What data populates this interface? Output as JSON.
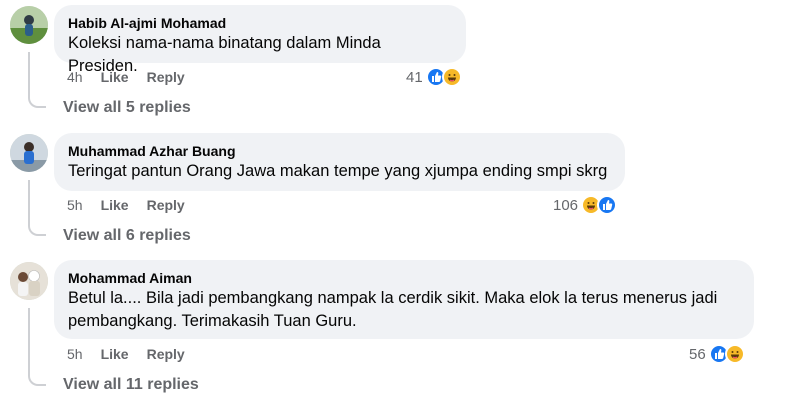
{
  "comments": [
    {
      "author": "Habib Al-ajmi Mohamad",
      "text": "Koleksi nama-nama binatang dalam Minda Presiden.",
      "time": "4h",
      "like_label": "Like",
      "reply_label": "Reply",
      "reaction_count": "41",
      "reaction_icons": [
        "like-icon",
        "haha-icon"
      ],
      "view_replies": "View all 5 replies"
    },
    {
      "author": "Muhammad Azhar Buang",
      "text": "Teringat pantun Orang Jawa makan tempe yang xjumpa ending smpi skrg",
      "time": "5h",
      "like_label": "Like",
      "reply_label": "Reply",
      "reaction_count": "106",
      "reaction_icons": [
        "haha-icon",
        "like-icon"
      ],
      "view_replies": "View all 6 replies"
    },
    {
      "author": "Mohammad Aiman",
      "text": "Betul la.... Bila jadi pembangkang nampak la cerdik sikit. Maka elok la terus menerus jadi\npembangkang. Terimakasih Tuan Guru.",
      "time": "5h",
      "like_label": "Like",
      "reply_label": "Reply",
      "reaction_count": "56",
      "reaction_icons": [
        "like-icon",
        "haha-icon"
      ],
      "view_replies": "View all 11 replies"
    }
  ],
  "colors": {
    "bubble": "#f0f2f5",
    "secondary_text": "#65676b",
    "like_blue": "#1877f2",
    "haha_yellow": "#f7b928"
  }
}
